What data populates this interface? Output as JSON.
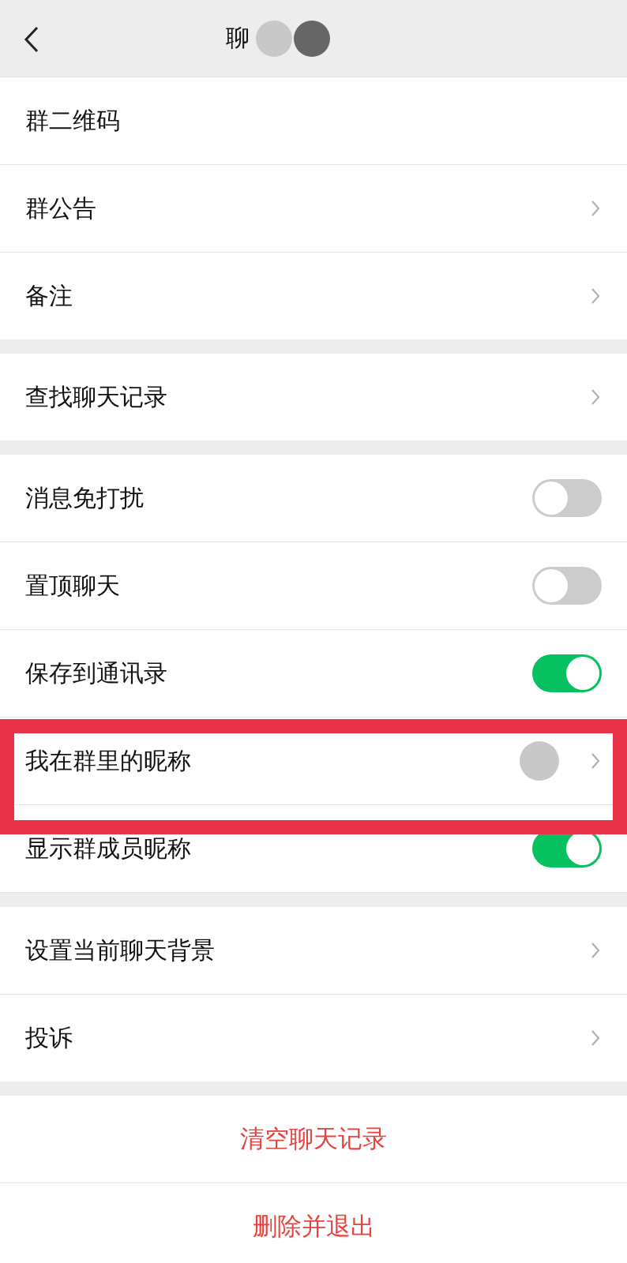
{
  "header": {
    "title": "聊"
  },
  "groups": [
    {
      "rows": [
        {
          "label": "群二维码",
          "kind": "plain",
          "highlighted": false
        },
        {
          "label": "群公告",
          "kind": "link",
          "highlighted": false
        },
        {
          "label": "备注",
          "kind": "link",
          "highlighted": false
        }
      ]
    },
    {
      "rows": [
        {
          "label": "查找聊天记录",
          "kind": "link",
          "highlighted": false
        }
      ]
    },
    {
      "rows": [
        {
          "label": "消息免打扰",
          "kind": "toggle",
          "on": false,
          "highlighted": false
        },
        {
          "label": "置顶聊天",
          "kind": "toggle",
          "on": false,
          "highlighted": false
        },
        {
          "label": "保存到通讯录",
          "kind": "toggle",
          "on": true,
          "highlighted": false
        },
        {
          "label": "我在群里的昵称",
          "kind": "link",
          "highlighted": true
        },
        {
          "label": "显示群成员昵称",
          "kind": "toggle",
          "on": true,
          "highlighted": false
        }
      ]
    },
    {
      "rows": [
        {
          "label": "设置当前聊天背景",
          "kind": "link",
          "highlighted": false
        },
        {
          "label": "投诉",
          "kind": "link",
          "highlighted": false
        }
      ]
    }
  ],
  "actions": [
    "清空聊天记录",
    "删除并退出"
  ]
}
